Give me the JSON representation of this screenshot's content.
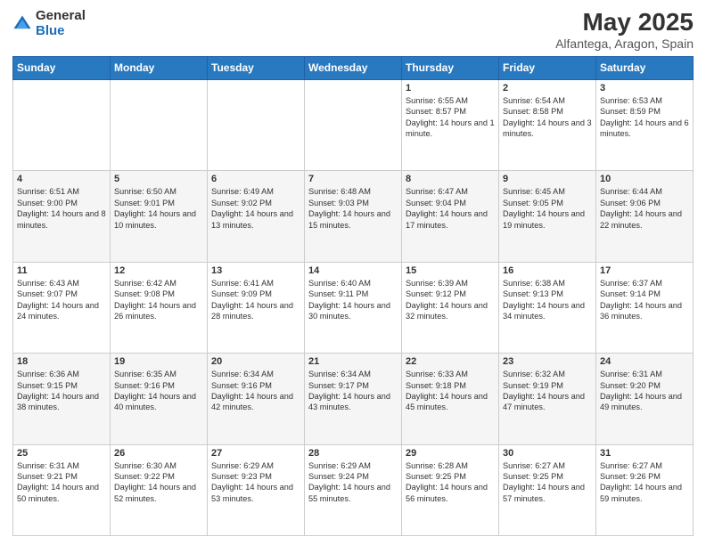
{
  "logo": {
    "general": "General",
    "blue": "Blue"
  },
  "title": "May 2025",
  "subtitle": "Alfantega, Aragon, Spain",
  "days_header": [
    "Sunday",
    "Monday",
    "Tuesday",
    "Wednesday",
    "Thursday",
    "Friday",
    "Saturday"
  ],
  "weeks": [
    [
      {
        "day": "",
        "info": ""
      },
      {
        "day": "",
        "info": ""
      },
      {
        "day": "",
        "info": ""
      },
      {
        "day": "",
        "info": ""
      },
      {
        "day": "1",
        "info": "Sunrise: 6:55 AM\nSunset: 8:57 PM\nDaylight: 14 hours and 1 minute."
      },
      {
        "day": "2",
        "info": "Sunrise: 6:54 AM\nSunset: 8:58 PM\nDaylight: 14 hours and 3 minutes."
      },
      {
        "day": "3",
        "info": "Sunrise: 6:53 AM\nSunset: 8:59 PM\nDaylight: 14 hours and 6 minutes."
      }
    ],
    [
      {
        "day": "4",
        "info": "Sunrise: 6:51 AM\nSunset: 9:00 PM\nDaylight: 14 hours and 8 minutes."
      },
      {
        "day": "5",
        "info": "Sunrise: 6:50 AM\nSunset: 9:01 PM\nDaylight: 14 hours and 10 minutes."
      },
      {
        "day": "6",
        "info": "Sunrise: 6:49 AM\nSunset: 9:02 PM\nDaylight: 14 hours and 13 minutes."
      },
      {
        "day": "7",
        "info": "Sunrise: 6:48 AM\nSunset: 9:03 PM\nDaylight: 14 hours and 15 minutes."
      },
      {
        "day": "8",
        "info": "Sunrise: 6:47 AM\nSunset: 9:04 PM\nDaylight: 14 hours and 17 minutes."
      },
      {
        "day": "9",
        "info": "Sunrise: 6:45 AM\nSunset: 9:05 PM\nDaylight: 14 hours and 19 minutes."
      },
      {
        "day": "10",
        "info": "Sunrise: 6:44 AM\nSunset: 9:06 PM\nDaylight: 14 hours and 22 minutes."
      }
    ],
    [
      {
        "day": "11",
        "info": "Sunrise: 6:43 AM\nSunset: 9:07 PM\nDaylight: 14 hours and 24 minutes."
      },
      {
        "day": "12",
        "info": "Sunrise: 6:42 AM\nSunset: 9:08 PM\nDaylight: 14 hours and 26 minutes."
      },
      {
        "day": "13",
        "info": "Sunrise: 6:41 AM\nSunset: 9:09 PM\nDaylight: 14 hours and 28 minutes."
      },
      {
        "day": "14",
        "info": "Sunrise: 6:40 AM\nSunset: 9:11 PM\nDaylight: 14 hours and 30 minutes."
      },
      {
        "day": "15",
        "info": "Sunrise: 6:39 AM\nSunset: 9:12 PM\nDaylight: 14 hours and 32 minutes."
      },
      {
        "day": "16",
        "info": "Sunrise: 6:38 AM\nSunset: 9:13 PM\nDaylight: 14 hours and 34 minutes."
      },
      {
        "day": "17",
        "info": "Sunrise: 6:37 AM\nSunset: 9:14 PM\nDaylight: 14 hours and 36 minutes."
      }
    ],
    [
      {
        "day": "18",
        "info": "Sunrise: 6:36 AM\nSunset: 9:15 PM\nDaylight: 14 hours and 38 minutes."
      },
      {
        "day": "19",
        "info": "Sunrise: 6:35 AM\nSunset: 9:16 PM\nDaylight: 14 hours and 40 minutes."
      },
      {
        "day": "20",
        "info": "Sunrise: 6:34 AM\nSunset: 9:16 PM\nDaylight: 14 hours and 42 minutes."
      },
      {
        "day": "21",
        "info": "Sunrise: 6:34 AM\nSunset: 9:17 PM\nDaylight: 14 hours and 43 minutes."
      },
      {
        "day": "22",
        "info": "Sunrise: 6:33 AM\nSunset: 9:18 PM\nDaylight: 14 hours and 45 minutes."
      },
      {
        "day": "23",
        "info": "Sunrise: 6:32 AM\nSunset: 9:19 PM\nDaylight: 14 hours and 47 minutes."
      },
      {
        "day": "24",
        "info": "Sunrise: 6:31 AM\nSunset: 9:20 PM\nDaylight: 14 hours and 49 minutes."
      }
    ],
    [
      {
        "day": "25",
        "info": "Sunrise: 6:31 AM\nSunset: 9:21 PM\nDaylight: 14 hours and 50 minutes."
      },
      {
        "day": "26",
        "info": "Sunrise: 6:30 AM\nSunset: 9:22 PM\nDaylight: 14 hours and 52 minutes."
      },
      {
        "day": "27",
        "info": "Sunrise: 6:29 AM\nSunset: 9:23 PM\nDaylight: 14 hours and 53 minutes."
      },
      {
        "day": "28",
        "info": "Sunrise: 6:29 AM\nSunset: 9:24 PM\nDaylight: 14 hours and 55 minutes."
      },
      {
        "day": "29",
        "info": "Sunrise: 6:28 AM\nSunset: 9:25 PM\nDaylight: 14 hours and 56 minutes."
      },
      {
        "day": "30",
        "info": "Sunrise: 6:27 AM\nSunset: 9:25 PM\nDaylight: 14 hours and 57 minutes."
      },
      {
        "day": "31",
        "info": "Sunrise: 6:27 AM\nSunset: 9:26 PM\nDaylight: 14 hours and 59 minutes."
      }
    ]
  ]
}
